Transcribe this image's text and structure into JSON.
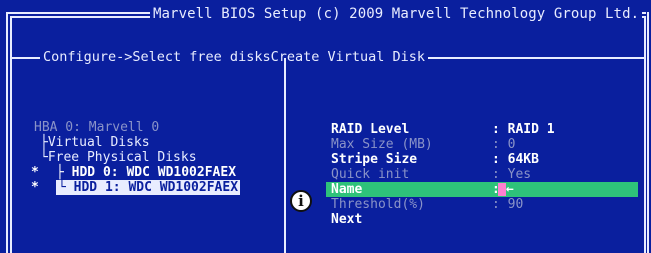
{
  "title": "Marvell BIOS Setup (c) 2009 Marvell Technology Group Ltd.",
  "breadcrumb": "Configure->Select free disksCreate Virtual Disk",
  "tree": {
    "hba": "HBA 0: Marvell 0",
    "virtual_disks": "Virtual Disks",
    "free_physical": "Free Physical Disks",
    "disks": [
      {
        "marker": "*",
        "label": "HDD 0: WDC WD1002FAEX",
        "highlighted": false
      },
      {
        "marker": "*",
        "label": "HDD 1: WDC WD1002FAEX",
        "highlighted": true
      }
    ]
  },
  "fields": [
    {
      "label": "RAID Level",
      "value": ": RAID 1",
      "style": "bright"
    },
    {
      "label": "Max Size (MB)",
      "value": ": 0",
      "style": "dim"
    },
    {
      "label": "Stripe Size",
      "value": ": 64KB",
      "style": "bright"
    },
    {
      "label": "Quick init",
      "value": ": Yes",
      "style": "dim"
    },
    {
      "label": "Name",
      "value": ":",
      "style": "active"
    },
    {
      "label": "Threshold(%)",
      "value": ": 90",
      "style": "dim"
    },
    {
      "label": "Next",
      "value": "",
      "style": "bright"
    }
  ],
  "colors": {
    "background": "#0a1f9e",
    "frame": "#e8ecff",
    "selection": "#2ec27a",
    "cursor": "#ff7fd0"
  },
  "icons": {
    "info": "info-icon"
  }
}
